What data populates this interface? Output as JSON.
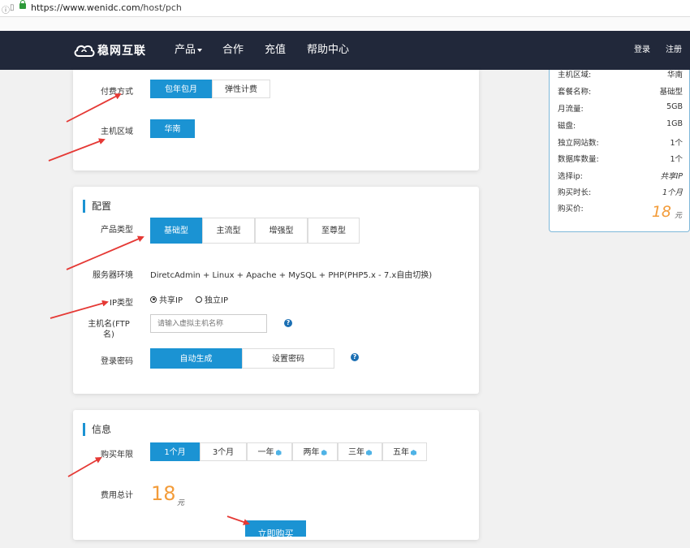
{
  "browser": {
    "url_host": "https://www.wenidc.com",
    "url_path": "/host/pch"
  },
  "nav": {
    "logo_text": "稳网互联",
    "menu": [
      "产品",
      "合作",
      "充值",
      "帮助中心"
    ],
    "login": "登录",
    "register": "注册"
  },
  "billing": {
    "pay_label": "付费方式",
    "pay_options": [
      "包年包月",
      "弹性计费"
    ],
    "region_label": "主机区域",
    "region_value": "华南"
  },
  "config": {
    "title": "配置",
    "product_type_label": "产品类型",
    "product_types": [
      "基础型",
      "主流型",
      "增强型",
      "至尊型"
    ],
    "server_env_label": "服务器环境",
    "server_env_value": "DiretcAdmin + Linux + Apache + MySQL + PHP(PHP5.x - 7.x自由切换)",
    "ip_type_label": "IP类型",
    "ip_options": [
      "共享IP",
      "独立IP"
    ],
    "hostname_label_1": "主机名(FTP",
    "hostname_label_2": "名)",
    "hostname_placeholder": "请输入虚拟主机名称",
    "password_label": "登录密码",
    "password_options": [
      "自动生成",
      "设置密码"
    ],
    "help_glyph": "?"
  },
  "info": {
    "title": "信息",
    "duration_label": "购买年限",
    "durations": [
      "1个月",
      "3个月",
      "一年",
      "两年",
      "三年",
      "五年"
    ],
    "total_label": "费用总计",
    "total_value": "18",
    "total_unit": "元",
    "buy_button": "立即购买"
  },
  "summary": {
    "rows": [
      {
        "k": "主机区域:",
        "v": "华南"
      },
      {
        "k": "套餐名称:",
        "v": "基础型"
      },
      {
        "k": "月流量:",
        "v": "5GB"
      },
      {
        "k": "磁盘:",
        "v": "1GB"
      },
      {
        "k": "独立网站数:",
        "v": "1个"
      },
      {
        "k": "数据库数量:",
        "v": "1个"
      },
      {
        "k": "选择ip:",
        "v": "共享IP"
      },
      {
        "k": "购买时长:",
        "v": "1个月"
      }
    ],
    "price_label": "购买价:",
    "price_value": "18",
    "price_unit": "元"
  },
  "colors": {
    "accent": "#1b93d3",
    "nav_bg": "#21283a",
    "price": "#f39c3a",
    "annotation_arrow": "#e53935"
  }
}
